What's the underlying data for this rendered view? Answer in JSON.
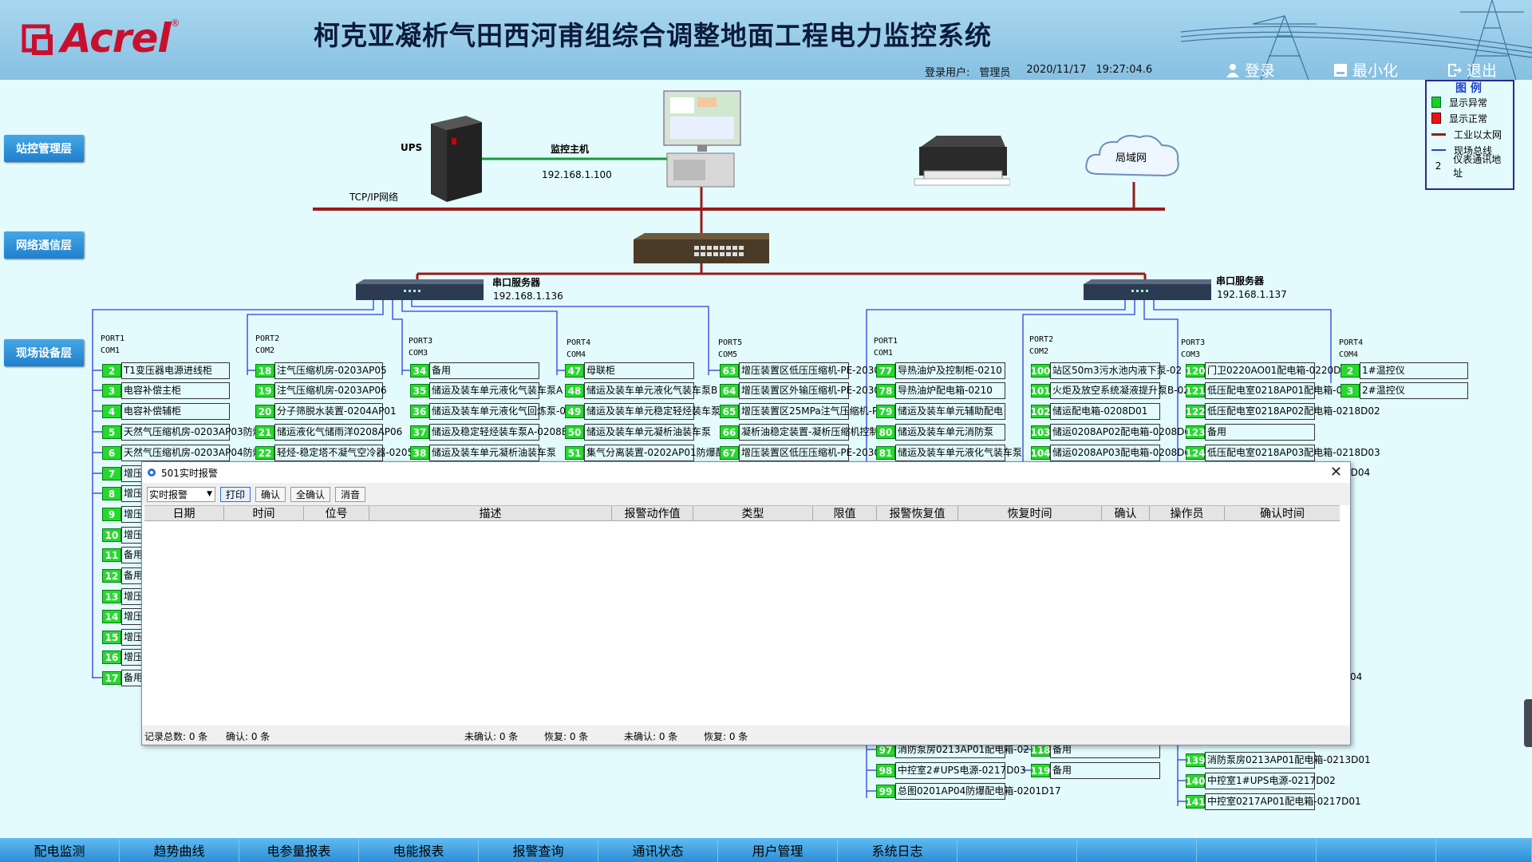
{
  "header": {
    "logo_text": "Acrel",
    "logo_reg": "®",
    "title": "柯克亚凝析气田西河甫组综合调整地面工程电力监控系统",
    "user_label": "登录用户:",
    "user": "管理员",
    "date": "2020/11/17",
    "time": "19:27:04.6",
    "login": "登录",
    "minimize": "最小化",
    "exit": "退出"
  },
  "layers": {
    "station": "站控管理层",
    "network": "网络通信层",
    "field": "现场设备层"
  },
  "legend": {
    "title": "图 例",
    "items": [
      {
        "label": "显示异常",
        "color": "#17d21f"
      },
      {
        "label": "显示正常",
        "color": "#ee1111"
      },
      {
        "label": "工业以太网",
        "color": "#9a1b1b"
      },
      {
        "label": "现场总线",
        "color": "#2a3fe0"
      },
      {
        "label": "仪表通讯地址",
        "num": "2"
      }
    ]
  },
  "network": {
    "ups": "UPS",
    "host": "监控主机",
    "host_ip": "192.168.1.100",
    "tcpip": "TCP/IP网络",
    "lan": "局域网",
    "serial1": "串口服务器",
    "serial1_ip": "192.168.1.136",
    "serial2": "串口服务器",
    "serial2_ip": "192.168.1.137"
  },
  "ports": [
    {
      "port": "PORT1",
      "com": "COM1"
    },
    {
      "port": "PORT2",
      "com": "COM2"
    },
    {
      "port": "PORT3",
      "com": "COM3"
    },
    {
      "port": "PORT4",
      "com": "COM4"
    },
    {
      "port": "PORT5",
      "com": "COM5"
    },
    {
      "port": "PORT1",
      "com": "COM1"
    },
    {
      "port": "PORT2",
      "com": "COM2"
    },
    {
      "port": "PORT3",
      "com": "COM3"
    },
    {
      "port": "PORT4",
      "com": "COM4"
    }
  ],
  "devices": {
    "col1": [
      {
        "n": "2",
        "t": "T1变压器电源进线柜"
      },
      {
        "n": "3",
        "t": "电容补偿主柜"
      },
      {
        "n": "4",
        "t": "电容补偿辅柜"
      },
      {
        "n": "5",
        "t": "天然气压缩机房-0203AP03防爆"
      },
      {
        "n": "6",
        "t": "天然气压缩机房-0203AP04防爆"
      },
      {
        "n": "7",
        "t": "增压"
      },
      {
        "n": "8",
        "t": "增压"
      },
      {
        "n": "9",
        "t": "增压"
      },
      {
        "n": "10",
        "t": "增压"
      },
      {
        "n": "11",
        "t": "备用"
      },
      {
        "n": "12",
        "t": "备用"
      },
      {
        "n": "13",
        "t": "增压"
      },
      {
        "n": "14",
        "t": "增压"
      },
      {
        "n": "15",
        "t": "增压"
      },
      {
        "n": "16",
        "t": "增压"
      },
      {
        "n": "17",
        "t": "备用"
      }
    ],
    "col2": [
      {
        "n": "18",
        "t": "注气压缩机房-0203AP05"
      },
      {
        "n": "19",
        "t": "注气压缩机房-0203AP06"
      },
      {
        "n": "20",
        "t": "分子筛脱水装置-0204AP01"
      },
      {
        "n": "21",
        "t": "储运液化气储雨洋0208AP06"
      },
      {
        "n": "22",
        "t": "轻烃-稳定塔不凝气空冷器-0205"
      }
    ],
    "col3": [
      {
        "n": "34",
        "t": "备用"
      },
      {
        "n": "35",
        "t": "储运及装车单元液化气装车泵A"
      },
      {
        "n": "36",
        "t": "储运及装车单元液化气回炼泵-0"
      },
      {
        "n": "37",
        "t": "储运及稳定轻烃装车泵A-0208E"
      },
      {
        "n": "38",
        "t": "储运及装车单元凝析油装车泵"
      }
    ],
    "col4": [
      {
        "n": "47",
        "t": "母联柜"
      },
      {
        "n": "48",
        "t": "储运及装车单元液化气装车泵B"
      },
      {
        "n": "49",
        "t": "储运及装车单元稳定轻烃装车泵"
      },
      {
        "n": "50",
        "t": "储运及装车单元凝析油装车泵"
      },
      {
        "n": "51",
        "t": "集气分离装置-0202AP01防爆配"
      }
    ],
    "col5": [
      {
        "n": "63",
        "t": "增压装置区低压压缩机-PE-2030"
      },
      {
        "n": "64",
        "t": "增压装置区外输压缩机-PE-2030"
      },
      {
        "n": "65",
        "t": "增压装置区25MPa注气压缩机-PE"
      },
      {
        "n": "66",
        "t": "凝析油稳定装置-凝析压缩机控制"
      },
      {
        "n": "67",
        "t": "增压装置区低压压缩机-PE-2030"
      }
    ],
    "col6": [
      {
        "n": "77",
        "t": "导热油炉及控制柜-0210"
      },
      {
        "n": "78",
        "t": "导热油炉配电箱-0210"
      },
      {
        "n": "79",
        "t": "储运及装车单元辅助配电"
      },
      {
        "n": "80",
        "t": "储运及装车单元消防泵"
      },
      {
        "n": "81",
        "t": "储运及装车单元液化气装车泵"
      },
      {
        "n": "97",
        "t": "消防泵房0213AP01配电箱-02"
      },
      {
        "n": "98",
        "t": "中控室2#UPS电源-0217D03"
      },
      {
        "n": "99",
        "t": "总图0201AP04防爆配电箱-0201D17"
      }
    ],
    "col7": [
      {
        "n": "100",
        "t": "站区50m3污水池内液下泵-02"
      },
      {
        "n": "101",
        "t": "火炬及放空系统凝液提升泵B-02"
      },
      {
        "n": "102",
        "t": "储运配电箱-0208D01"
      },
      {
        "n": "103",
        "t": "储运0208AP02配电箱-0208D02"
      },
      {
        "n": "104",
        "t": "储运0208AP03配电箱-0208D03"
      },
      {
        "n": "118",
        "t": "备用"
      },
      {
        "n": "119",
        "t": "备用"
      }
    ],
    "col8": [
      {
        "n": "120",
        "t": "门卫0220AO01配电箱-0220D0"
      },
      {
        "n": "121",
        "t": "低压配电室0218AP01配电箱-0"
      },
      {
        "n": "122",
        "t": "低压配电室0218AP02配电箱-0218D02"
      },
      {
        "n": "123",
        "t": "备用"
      },
      {
        "n": "124",
        "t": "低压配电室0218AP03配电箱-0218D03"
      },
      {
        "n": "139",
        "t": "消防泵房0213AP01配电箱-0213D01"
      },
      {
        "n": "140",
        "t": "中控室1#UPS电源-0217D02"
      },
      {
        "n": "141",
        "t": "中控室0217AP01配电箱-0217D01"
      }
    ],
    "col9": [
      {
        "n": "2",
        "t": "1#温控仪"
      },
      {
        "n": "3",
        "t": "2#温控仪"
      }
    ],
    "peek": [
      "3D04",
      "04"
    ]
  },
  "dialog": {
    "title": "501实时报警",
    "filter": "实时报警",
    "buttons": [
      "打印",
      "确认",
      "全确认",
      "消音"
    ],
    "columns": [
      "日期",
      "时间",
      "位号",
      "描述",
      "报警动作值",
      "类型",
      "限值",
      "报警恢复值",
      "恢复时间",
      "确认",
      "操作员",
      "确认时间"
    ],
    "footer": [
      "记录总数: 0 条",
      "确认: 0 条",
      "未确认: 0 条",
      "恢复: 0 条",
      "未确认: 0 条",
      "恢复: 0 条"
    ]
  },
  "nav": [
    "配电监测",
    "趋势曲线",
    "电参量报表",
    "电能报表",
    "报警查询",
    "通讯状态",
    "用户管理",
    "系统日志",
    "",
    "",
    "",
    "",
    ""
  ]
}
